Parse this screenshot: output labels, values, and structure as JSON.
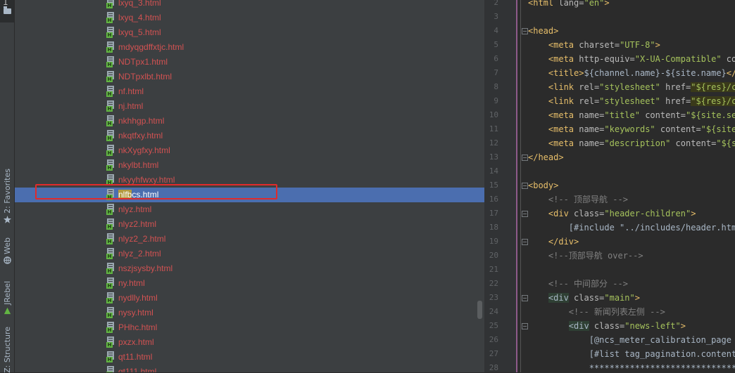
{
  "tool_strip": {
    "project_tab_number": "1",
    "tabs": [
      {
        "label": "2: Favorites",
        "icon": "star-icon"
      },
      {
        "label": "Web",
        "icon": "web-icon"
      },
      {
        "label": "JRebel",
        "icon": "jrebel-icon"
      },
      {
        "label": "Z: Structure",
        "icon": "structure-icon"
      }
    ]
  },
  "project_tree": {
    "files": [
      {
        "name": "lxyq_3.html"
      },
      {
        "name": "lxyq_4.html"
      },
      {
        "name": "lxyq_5.html"
      },
      {
        "name": "mdyqgdffxtjc.html"
      },
      {
        "name": "NDTpx1.html"
      },
      {
        "name": "NDTpxlbt.html"
      },
      {
        "name": "nf.html"
      },
      {
        "name": "nj.html"
      },
      {
        "name": "nkhhgp.html"
      },
      {
        "name": "nkqtfxy.html"
      },
      {
        "name": "nkXygfxy.html"
      },
      {
        "name": "nkylbt.html"
      },
      {
        "name": "nkyyhfwxy.html"
      },
      {
        "name_highlight": "nlfb",
        "name_rest": "cs.html",
        "selected": true
      },
      {
        "name": "nlyz.html"
      },
      {
        "name": "nlyz2.html"
      },
      {
        "name": "nlyz2_2.html"
      },
      {
        "name": "nlyz_2.html"
      },
      {
        "name": "nszjsysby.html"
      },
      {
        "name": "ny.html"
      },
      {
        "name": "nydlly.html"
      },
      {
        "name": "nysy.html"
      },
      {
        "name": "PHhc.html"
      },
      {
        "name": "pxzx.html"
      },
      {
        "name": "qt11.html"
      },
      {
        "name": "qt111.html"
      }
    ],
    "file_badge": "H"
  },
  "editor": {
    "lines": [
      {
        "n": "2",
        "c": [
          [
            "tag",
            "<html "
          ],
          [
            "attr",
            "lang="
          ],
          [
            "val",
            "\"en\""
          ],
          [
            "tag",
            ">"
          ]
        ]
      },
      {
        "n": "3",
        "c": []
      },
      {
        "n": "4",
        "c": [
          [
            "tag",
            "<head>"
          ]
        ]
      },
      {
        "n": "5",
        "c": [
          [
            "fm",
            "    "
          ],
          [
            "tag",
            "<meta "
          ],
          [
            "attr",
            "charset="
          ],
          [
            "val",
            "\"UTF-8\""
          ],
          [
            "tag",
            ">"
          ]
        ]
      },
      {
        "n": "6",
        "c": [
          [
            "fm",
            "    "
          ],
          [
            "tag",
            "<meta "
          ],
          [
            "attr",
            "http-equiv="
          ],
          [
            "val",
            "\"X-UA-Compatible\""
          ],
          [
            "attr",
            " con"
          ]
        ]
      },
      {
        "n": "7",
        "c": [
          [
            "fm",
            "    "
          ],
          [
            "tag",
            "<title>"
          ],
          [
            "fm",
            "${channel.name}-${site.name}"
          ],
          [
            "tag",
            "</t"
          ]
        ]
      },
      {
        "n": "8",
        "c": [
          [
            "fm",
            "    "
          ],
          [
            "tag",
            "<link "
          ],
          [
            "attr",
            "rel="
          ],
          [
            "val",
            "\"stylesheet\""
          ],
          [
            "attr",
            " href="
          ],
          [
            "fmhl",
            "\"${res}/cs"
          ]
        ]
      },
      {
        "n": "9",
        "c": [
          [
            "fm",
            "    "
          ],
          [
            "tag",
            "<link "
          ],
          [
            "attr",
            "rel="
          ],
          [
            "val",
            "\"stylesheet\""
          ],
          [
            "attr",
            " href="
          ],
          [
            "fmhl",
            "\"${res}/cs"
          ]
        ]
      },
      {
        "n": "10",
        "c": [
          [
            "fm",
            "    "
          ],
          [
            "tag",
            "<meta "
          ],
          [
            "attr",
            "name="
          ],
          [
            "val",
            "\"title\""
          ],
          [
            "attr",
            " content="
          ],
          [
            "val",
            "\"${site.seo"
          ]
        ]
      },
      {
        "n": "11",
        "c": [
          [
            "fm",
            "    "
          ],
          [
            "tag",
            "<meta "
          ],
          [
            "attr",
            "name="
          ],
          [
            "val",
            "\"keywords\""
          ],
          [
            "attr",
            " content="
          ],
          [
            "val",
            "\"${site."
          ]
        ]
      },
      {
        "n": "12",
        "c": [
          [
            "fm",
            "    "
          ],
          [
            "tag",
            "<meta "
          ],
          [
            "attr",
            "name="
          ],
          [
            "val",
            "\"description\""
          ],
          [
            "attr",
            " content="
          ],
          [
            "val",
            "\"${si"
          ]
        ]
      },
      {
        "n": "13",
        "c": [
          [
            "tag",
            "</head>"
          ]
        ]
      },
      {
        "n": "14",
        "c": []
      },
      {
        "n": "15",
        "c": [
          [
            "tag",
            "<body>"
          ]
        ]
      },
      {
        "n": "16",
        "c": [
          [
            "fm",
            "    "
          ],
          [
            "cmt",
            "<!-- 顶部导航 -->"
          ]
        ]
      },
      {
        "n": "17",
        "c": [
          [
            "fm",
            "    "
          ],
          [
            "tag",
            "<div "
          ],
          [
            "attr",
            "class="
          ],
          [
            "val",
            "\"header-children\""
          ],
          [
            "tag",
            ">"
          ]
        ]
      },
      {
        "n": "18",
        "c": [
          [
            "fm",
            "        [#include \"../includes/header.html"
          ]
        ]
      },
      {
        "n": "19",
        "c": [
          [
            "fm",
            "    "
          ],
          [
            "tag",
            "</div>"
          ]
        ]
      },
      {
        "n": "20",
        "c": [
          [
            "fm",
            "    "
          ],
          [
            "cmt",
            "<!--顶部导航 over-->"
          ]
        ]
      },
      {
        "n": "21",
        "c": []
      },
      {
        "n": "22",
        "c": [
          [
            "fm",
            "    "
          ],
          [
            "cmt",
            "<!-- 中间部分 -->"
          ]
        ]
      },
      {
        "n": "23",
        "c": [
          [
            "fm",
            "    "
          ],
          [
            "taghl",
            "<div"
          ],
          [
            "attr",
            " class="
          ],
          [
            "val",
            "\"main\""
          ],
          [
            "tag",
            ">"
          ]
        ]
      },
      {
        "n": "24",
        "c": [
          [
            "fm",
            "        "
          ],
          [
            "cmt",
            "<!-- 新闻列表左侧 -->"
          ]
        ]
      },
      {
        "n": "25",
        "c": [
          [
            "fm",
            "        "
          ],
          [
            "taghl",
            "<div"
          ],
          [
            "attr",
            " class="
          ],
          [
            "val",
            "\"news-left\""
          ],
          [
            "tag",
            ">"
          ]
        ]
      },
      {
        "n": "26",
        "c": [
          [
            "fm",
            "            [@ncs_meter_calibration_page c"
          ]
        ]
      },
      {
        "n": "27",
        "c": [
          [
            "fm",
            "            [#list tag_pagination.content "
          ]
        ]
      },
      {
        "n": "28",
        "c": [
          [
            "fm",
            "            ******************************"
          ]
        ]
      }
    ]
  }
}
